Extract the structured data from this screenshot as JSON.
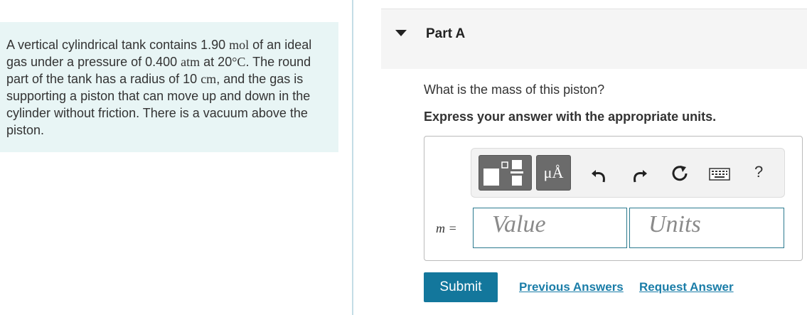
{
  "problem": {
    "t1": "A vertical cylindrical tank contains 1.90 ",
    "u1": "mol",
    "t2": " of an ideal gas under a pressure of 0.400 ",
    "u2": "atm",
    "t3": " at 20",
    "u3": "°C",
    "t4": ". The round part of the tank has a radius of 10 ",
    "u4": "cm",
    "t5": ", and the gas is supporting a piston that can move up and down in the cylinder without friction. There is a vacuum above the piston."
  },
  "part": {
    "title": "Part A",
    "caret_icon": "caret-down-icon"
  },
  "question": "What is the mass of this piston?",
  "instruction": "Express your answer with the appropriate units.",
  "toolbar": {
    "units_label": "μÅ",
    "help_label": "?",
    "icons": [
      "template-icon",
      "units-icon",
      "undo-icon",
      "redo-icon",
      "reset-icon",
      "keyboard-icon",
      "help-icon"
    ]
  },
  "answer": {
    "variable": "m =",
    "value_placeholder": "Value",
    "units_placeholder": "Units"
  },
  "actions": {
    "submit": "Submit",
    "previous_answers": "Previous Answers",
    "request_answer": "Request Answer"
  },
  "colors": {
    "problem_bg": "#e8f5f5",
    "accent": "#13779c",
    "link": "#1a7da8",
    "input_border": "#2b7a8f"
  }
}
